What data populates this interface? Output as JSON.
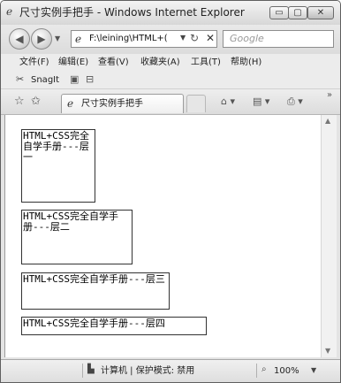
{
  "window": {
    "title": "尺寸实例手把手 - Windows Internet Explorer",
    "controls": {
      "minimize": "▭",
      "maximize": "▢",
      "close": "✕"
    }
  },
  "address_bar": {
    "url": "F:\\leining\\HTML+(",
    "page_icon": "ie-page-icon",
    "refresh": "↻",
    "stop": "✕"
  },
  "search": {
    "placeholder": "Google"
  },
  "menu": [
    "文件(F)",
    "编辑(E)",
    "查看(V)",
    "收藏夹(A)",
    "工具(T)",
    "帮助(H)"
  ],
  "snagit": {
    "label": "SnagIt"
  },
  "tab": {
    "title": "尺寸实例手把手"
  },
  "content": {
    "layers": [
      "HTML+CSS完全自学手册---层一",
      "HTML+CSS完全自学手册---层二",
      "HTML+CSS完全自学手册---层三",
      "HTML+CSS完全自学手册---层四"
    ]
  },
  "status": {
    "zone": "计算机 | 保护模式: 禁用",
    "zoom": "100%"
  },
  "colors": {
    "frame": "#5f5f5f",
    "chrome": "#e4e4e4",
    "content_bg": "#ffffff",
    "box_border": "#333333"
  }
}
